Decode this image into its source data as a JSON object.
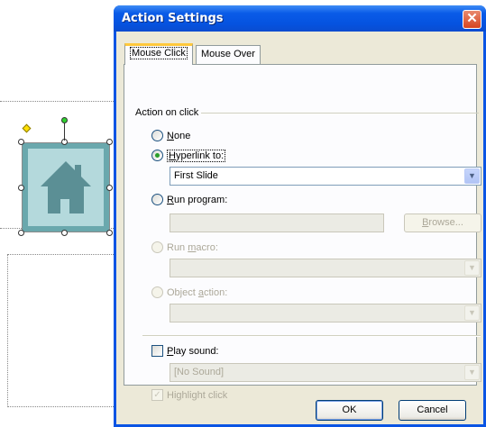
{
  "dialog": {
    "title": "Action Settings",
    "close_glyph": "✕"
  },
  "tabs": [
    {
      "label": "Mouse Click",
      "active": true
    },
    {
      "label": "Mouse Over",
      "active": false
    }
  ],
  "action_group": {
    "label": "Action on click",
    "none": {
      "label_mnemonic": "N",
      "label_rest": "one",
      "checked": false
    },
    "hyperlink": {
      "label_mnemonic": "H",
      "label_rest": "yperlink to:",
      "checked": true,
      "value": "First Slide"
    },
    "run_program": {
      "label_mnemonic": "R",
      "label_rest": "un program:",
      "checked": false,
      "path_value": "",
      "browse_mnemonic": "B",
      "browse_rest": "rowse..."
    },
    "run_macro": {
      "label_prefix": "Run ",
      "label_mnemonic": "m",
      "label_rest": "acro:",
      "enabled": false,
      "value": ""
    },
    "object_action": {
      "label_prefix": "Object ",
      "label_mnemonic": "a",
      "label_rest": "ction:",
      "enabled": false,
      "value": ""
    }
  },
  "play_sound": {
    "label_mnemonic": "P",
    "label_rest": "lay sound:",
    "checked": false,
    "value": "[No Sound]"
  },
  "highlight_click": {
    "label": "Highlight click",
    "checked": true,
    "enabled": false,
    "check_glyph": "✓"
  },
  "buttons": {
    "ok": "OK",
    "cancel": "Cancel"
  },
  "dropdown_arrow_glyph": "▼",
  "colors": {
    "title_bar": "#0a54e4",
    "client": "#ece9d8",
    "button_shape": "#6aa8ad",
    "selected_radio": "#2a9e2a"
  }
}
